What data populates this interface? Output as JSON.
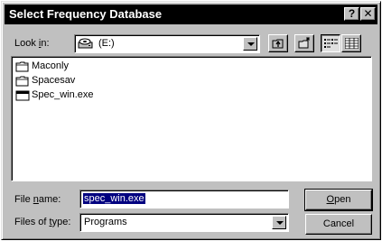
{
  "window": {
    "title": "Select Frequency Database",
    "help_label": "?",
    "close_label": "✕"
  },
  "lookin": {
    "label_prefix": "Look ",
    "label_accel": "i",
    "label_suffix": "n:",
    "drive_icon": "disk-drive-icon",
    "value": "(E:)"
  },
  "toolbar": {
    "up_icon": "up-one-level-icon",
    "newfolder_icon": "new-folder-icon",
    "list_icon": "list-view-icon",
    "details_icon": "details-view-icon"
  },
  "files": [
    {
      "name": "Maconly",
      "icon": "folder-icon"
    },
    {
      "name": "Spacesav",
      "icon": "folder-icon"
    },
    {
      "name": "Spec_win.exe",
      "icon": "application-icon"
    }
  ],
  "filename": {
    "label_prefix": "File ",
    "label_accel": "n",
    "label_suffix": "ame:",
    "value": "spec_win.exe"
  },
  "filetype": {
    "label_prefix": "Files of ",
    "label_accel": "t",
    "label_suffix": "ype:",
    "value": "Programs"
  },
  "buttons": {
    "open_accel": "O",
    "open_rest": "pen",
    "cancel": "Cancel"
  }
}
